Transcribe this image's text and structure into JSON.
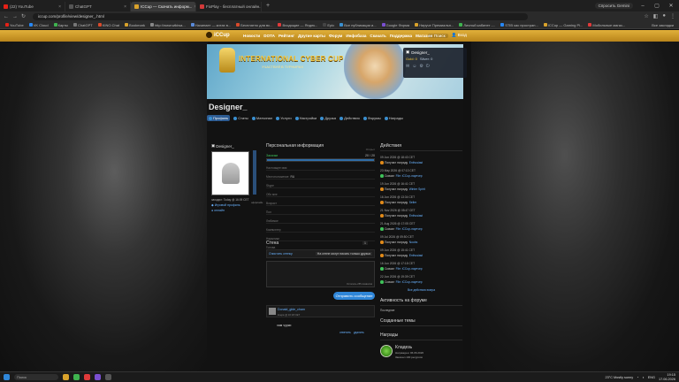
{
  "browser": {
    "tabs": [
      {
        "title": "(22) YouTube",
        "color": "#e62117",
        "active": false
      },
      {
        "title": "ChatGPT",
        "color": "#555555",
        "active": false
      },
      {
        "title": "ICCup — Скачать информ...",
        "color": "#d9a22b",
        "active": true
      },
      {
        "title": "FixPlay - бесплатный онлайн...",
        "color": "#d33a3a",
        "active": false
      }
    ],
    "gemini_label": "Спросить Gemini",
    "url": "iccup.com/profile/view/designer_.html",
    "bookmarks": [
      {
        "label": "YouTube",
        "color": "#e62117"
      },
      {
        "label": "VK Cloud",
        "color": "#2787f5"
      },
      {
        "label": "Карты",
        "color": "#3fb34f"
      },
      {
        "label": "ChatGPT",
        "color": "#777777"
      },
      {
        "label": "KINO.Chat",
        "color": "#d94a2b"
      },
      {
        "label": "Bookmark",
        "color": "#d9a22b"
      },
      {
        "label": "http://www.wikiwa...",
        "color": "#888888"
      },
      {
        "label": "Начинает — китах в...",
        "color": "#5a8ad9"
      },
      {
        "label": "Бесплатно для вс...",
        "color": "#d94a2b"
      },
      {
        "label": "Входящие — Яндек...",
        "color": "#e03a3a"
      },
      {
        "label": "Epic",
        "color": "#444444"
      },
      {
        "label": "Все публикации и...",
        "color": "#3a8fd0"
      },
      {
        "label": "Google Форма",
        "color": "#7a4fd0"
      },
      {
        "label": "Нируче Премиальн...",
        "color": "#d9a22b"
      },
      {
        "label": "Личный кабинет -...",
        "color": "#3fb34f"
      },
      {
        "label": "STIB кас простран...",
        "color": "#2787f5"
      },
      {
        "label": "ICCup — Gaming Pl...",
        "color": "#d9a22b"
      },
      {
        "label": "Мобильные магаз...",
        "color": "#e03a3a"
      }
    ],
    "all_bookmarks": "Все закладки"
  },
  "site": {
    "logo": "iCCup",
    "nav": [
      "Новости",
      "DOTA",
      "Рейтинг",
      "Другие карты",
      "Форум",
      "Инфобаза",
      "Скачать",
      "Поддержка",
      "Магазин"
    ],
    "nav_search": "Поиск",
    "nav_user": "Вход",
    "banner_title": "INTERNATIONAL CYBER CUP",
    "banner_sub": "УЧАСТВУЙ В ТУРНИРАХ",
    "userbox": {
      "name": "Designer_",
      "gold_label": "Gold: 0",
      "silver_label": "Silver: 0"
    }
  },
  "profile": {
    "title": "Designer_",
    "tabs": [
      "Профиль",
      "Статы",
      "Матчинал",
      "Услуги",
      "Настройки",
      "Друзья",
      "Действия",
      "Форумы",
      "Награды"
    ],
    "active_tab": 0,
    "left": {
      "name": "Designer_",
      "meta": "заходил: Today @ 16:09 CET",
      "side_label": "оффлайн",
      "link1": "Игровой профиль",
      "link2": "онлайн"
    },
    "personal": {
      "heading": "Персональная информация",
      "opened": "Открыт",
      "downloads_label": "Закачки",
      "downloads_value": "20 / 20",
      "progress": 1.0,
      "fields": [
        {
          "label": "Настоящее имя",
          "value": ""
        },
        {
          "label": "Местоположение",
          "value": "RU"
        },
        {
          "label": "Skype",
          "value": ""
        },
        {
          "label": "Обо мне",
          "value": ""
        },
        {
          "label": "Возраст",
          "value": ""
        },
        {
          "label": "Пол",
          "value": ""
        },
        {
          "label": "Любимое",
          "value": ""
        },
        {
          "label": "Компьютер",
          "value": ""
        },
        {
          "label": "Наушники",
          "value": ""
        },
        {
          "label": "Голова",
          "value": ""
        }
      ]
    },
    "wall": {
      "heading": "Стена",
      "page": "1",
      "clear": "Очистить стенку",
      "select": "На стене могут писать только друзья",
      "counter": "Осталось 255 символов",
      "send": "Отправить сообщение",
      "post_author": "Donald_gble_cham",
      "post_date": "вчера @ 16:18 CET",
      "post_text": "хам чурки",
      "post_reply": "ответить",
      "post_delete": "удалить"
    },
    "actions": {
      "heading": "Действия",
      "items": [
        {
          "date": "09 Jun 2026 @ 18:43 CET",
          "text": "Получил награду",
          "link": "Enthusiast",
          "kind": "award"
        },
        {
          "date": "23 May 2026 @ 07:13 CET",
          "text": "Скачал",
          "link": "File: iCCup-лаунчер",
          "kind": "file"
        },
        {
          "date": "19 Jun 2026 @ 16:41 CET",
          "text": "Получил награду",
          "link": "Winter Spirit",
          "kind": "award"
        },
        {
          "date": "16 Jun 2026 @ 13:34 CET",
          "text": "Получил награду",
          "link": "Seller",
          "kind": "award"
        },
        {
          "date": "21 Nov 2026 @ 05:47 CET",
          "text": "Получил награду",
          "link": "Enthusiast",
          "kind": "award"
        },
        {
          "date": "21 Aug 2026 @ 17:05 CET",
          "text": "Скачал",
          "link": "File: iCCup-лаунчер",
          "kind": "file"
        },
        {
          "date": "09 Jul 2026 @ 09:50 CET",
          "text": "Получил награду",
          "link": "Noobs",
          "kind": "award"
        },
        {
          "date": "09 Jun 2026 @ 15:41 CET",
          "text": "Получил награду",
          "link": "Enthusiast",
          "kind": "award"
        },
        {
          "date": "16 Jun 2026 @ 17:18 CET",
          "text": "Скачал",
          "link": "File: iCCup-лаунчер",
          "kind": "file"
        },
        {
          "date": "22 Jun 2026 @ 19:39 CET",
          "text": "Скачал",
          "link": "File: iCCup-лаунчер",
          "kind": "file"
        }
      ],
      "all": "Все действия юзера"
    },
    "forum": {
      "heading": "Активность на форуме",
      "sub": "Последние"
    },
    "themes": {
      "heading": "Созданные темы"
    },
    "awards": {
      "heading": "Награды",
      "title": "Кладезь",
      "line1": "Награжден: 06.06.2026",
      "line2": "Закачал 100 ресурсов"
    }
  },
  "taskbar": {
    "search": "Поиск",
    "weather": "23°C  Mostly sunny",
    "lang": "ENG",
    "time": "19:15",
    "date": "17.06.2026"
  }
}
